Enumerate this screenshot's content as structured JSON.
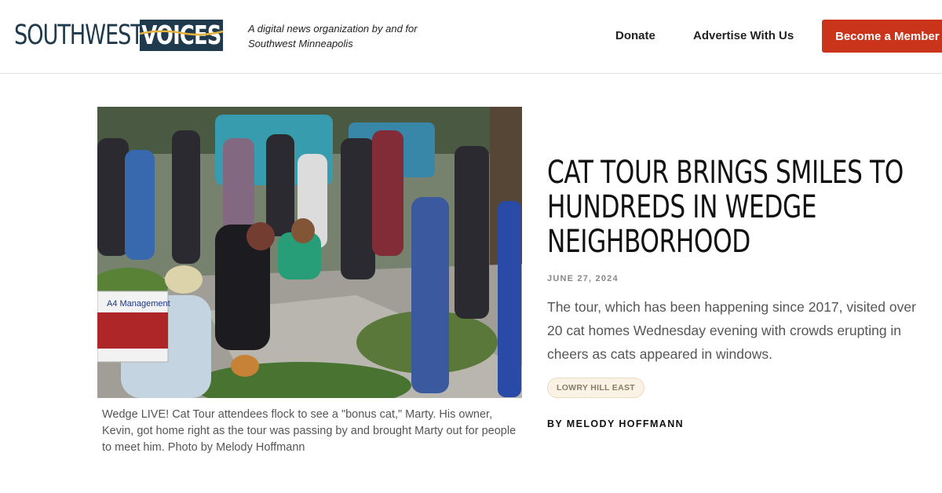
{
  "header": {
    "logo_word1": "SOUTHWEST",
    "logo_word2": "VOICES",
    "tagline": "A digital news organization by and for Southwest Minneapolis",
    "nav": {
      "donate": "Donate",
      "advertise": "Advertise With Us",
      "member": "Become a Member"
    }
  },
  "article": {
    "headline": "CAT TOUR BRINGS SMILES TO HUNDREDS IN WEDGE NEIGHBORHOOD",
    "date": "JUNE 27, 2024",
    "excerpt": "The tour, which has been happening since 2017, visited over 20 cat homes Wednesday evening with crowds erupting in cheers as cats appeared in windows.",
    "tag": "LOWRY HILL EAST",
    "byline": "BY MELODY HOFFMANN",
    "caption": "Wedge LIVE! Cat Tour attendees flock to see a \"bonus cat,\" Marty. His owner, Kevin, got home right as the tour was passing by and brought Marty out for people to meet him. Photo by Melody Hoffmann",
    "photo_sign_text": "A4 Management"
  },
  "colors": {
    "brand_navy": "#1f3a4d",
    "accent_red": "#c9341b",
    "tag_bg": "#fbf2e6"
  }
}
